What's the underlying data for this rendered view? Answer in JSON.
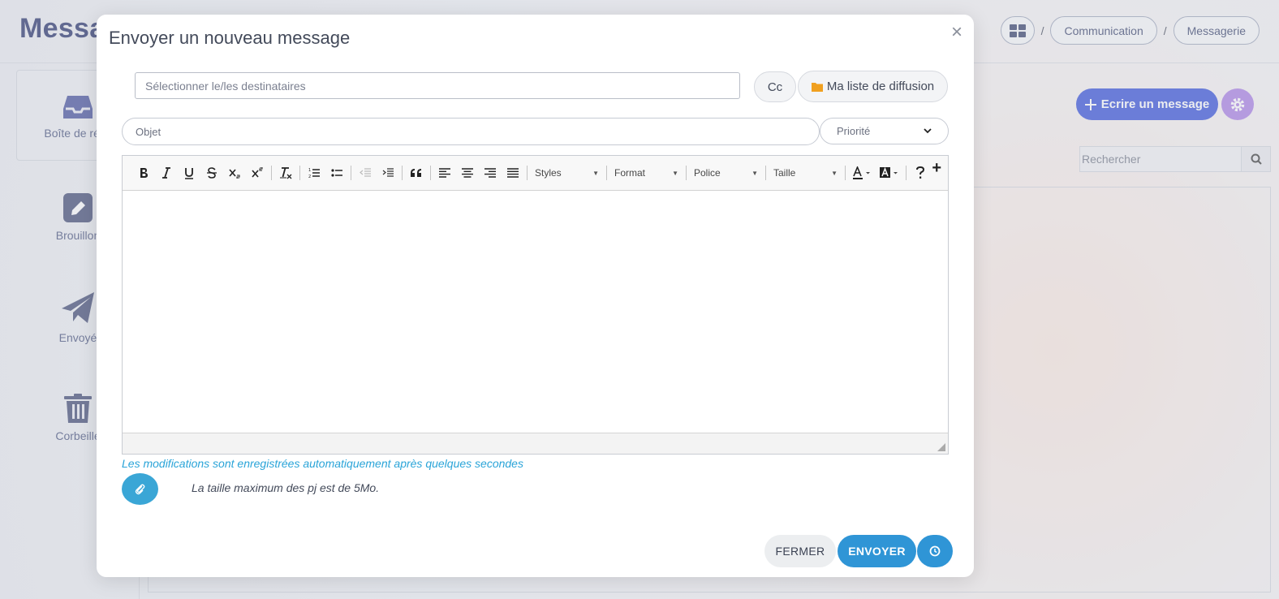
{
  "page": {
    "title": "Messa",
    "breadcrumb": {
      "items": [
        "Communication",
        "Messagerie"
      ],
      "separator": "/"
    },
    "sidebar": {
      "inbox_label": "Boîte de réce",
      "drafts_label": "Brouillon",
      "sent_label": "Envoyé",
      "trash_label": "Corbeille"
    },
    "write_button": "Ecrire un message",
    "search_placeholder": "Rechercher"
  },
  "modal": {
    "title": "Envoyer un nouveau message",
    "close_glyph": "×",
    "recipients_placeholder": "Sélectionner le/les destinataires",
    "cc_label": "Cc",
    "broadcast_list_label": "Ma liste de diffusion",
    "subject_placeholder": "Objet",
    "priority_selected": "Priorité",
    "editor": {
      "combos": {
        "styles": "Styles",
        "format": "Format",
        "font": "Police",
        "size": "Taille"
      }
    },
    "autosave_note": "Les modifications sont enregistrées automatiquement après quelques secondes",
    "max_attachment_note": "La taille maximum des pj est de 5Mo.",
    "close_button": "FERMER",
    "send_button": "ENVOYER"
  },
  "colors": {
    "brand_navy": "#1f2a66",
    "primary_blue": "#2f4bd8",
    "send_blue": "#2f95d6",
    "autosave_text": "#2aa4d8",
    "settings_purple": "#a77be4",
    "folder_orange": "#f0a020"
  }
}
